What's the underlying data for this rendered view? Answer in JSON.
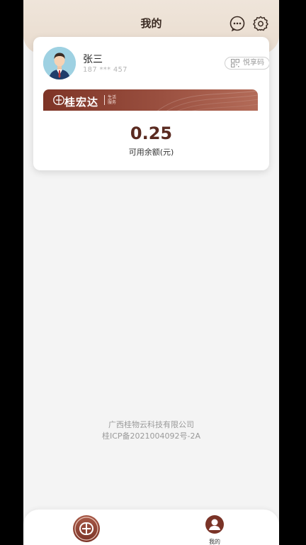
{
  "header": {
    "title": "我的"
  },
  "icons": {
    "message": "chat-bubble-icon",
    "settings": "gear-icon",
    "qr": "qr-code-icon"
  },
  "profile": {
    "name": "张三",
    "phone": "187 *** 457",
    "qr_label": "悦享码"
  },
  "brand": {
    "name": "桂宏达",
    "sub_line1": "生活",
    "sub_line2": "服务"
  },
  "balance": {
    "value": "0.25",
    "label": "可用余额(元)"
  },
  "footer": {
    "company": "广西桂物云科技有限公司",
    "icp": "桂ICP备2021004092号-2A"
  },
  "tabbar": {
    "home_icon": "brand-logo-icon",
    "mine_label": "我的"
  },
  "colors": {
    "accent": "#7e3426",
    "balance_text": "#5a2a20",
    "header_bg": "#efe5da"
  }
}
